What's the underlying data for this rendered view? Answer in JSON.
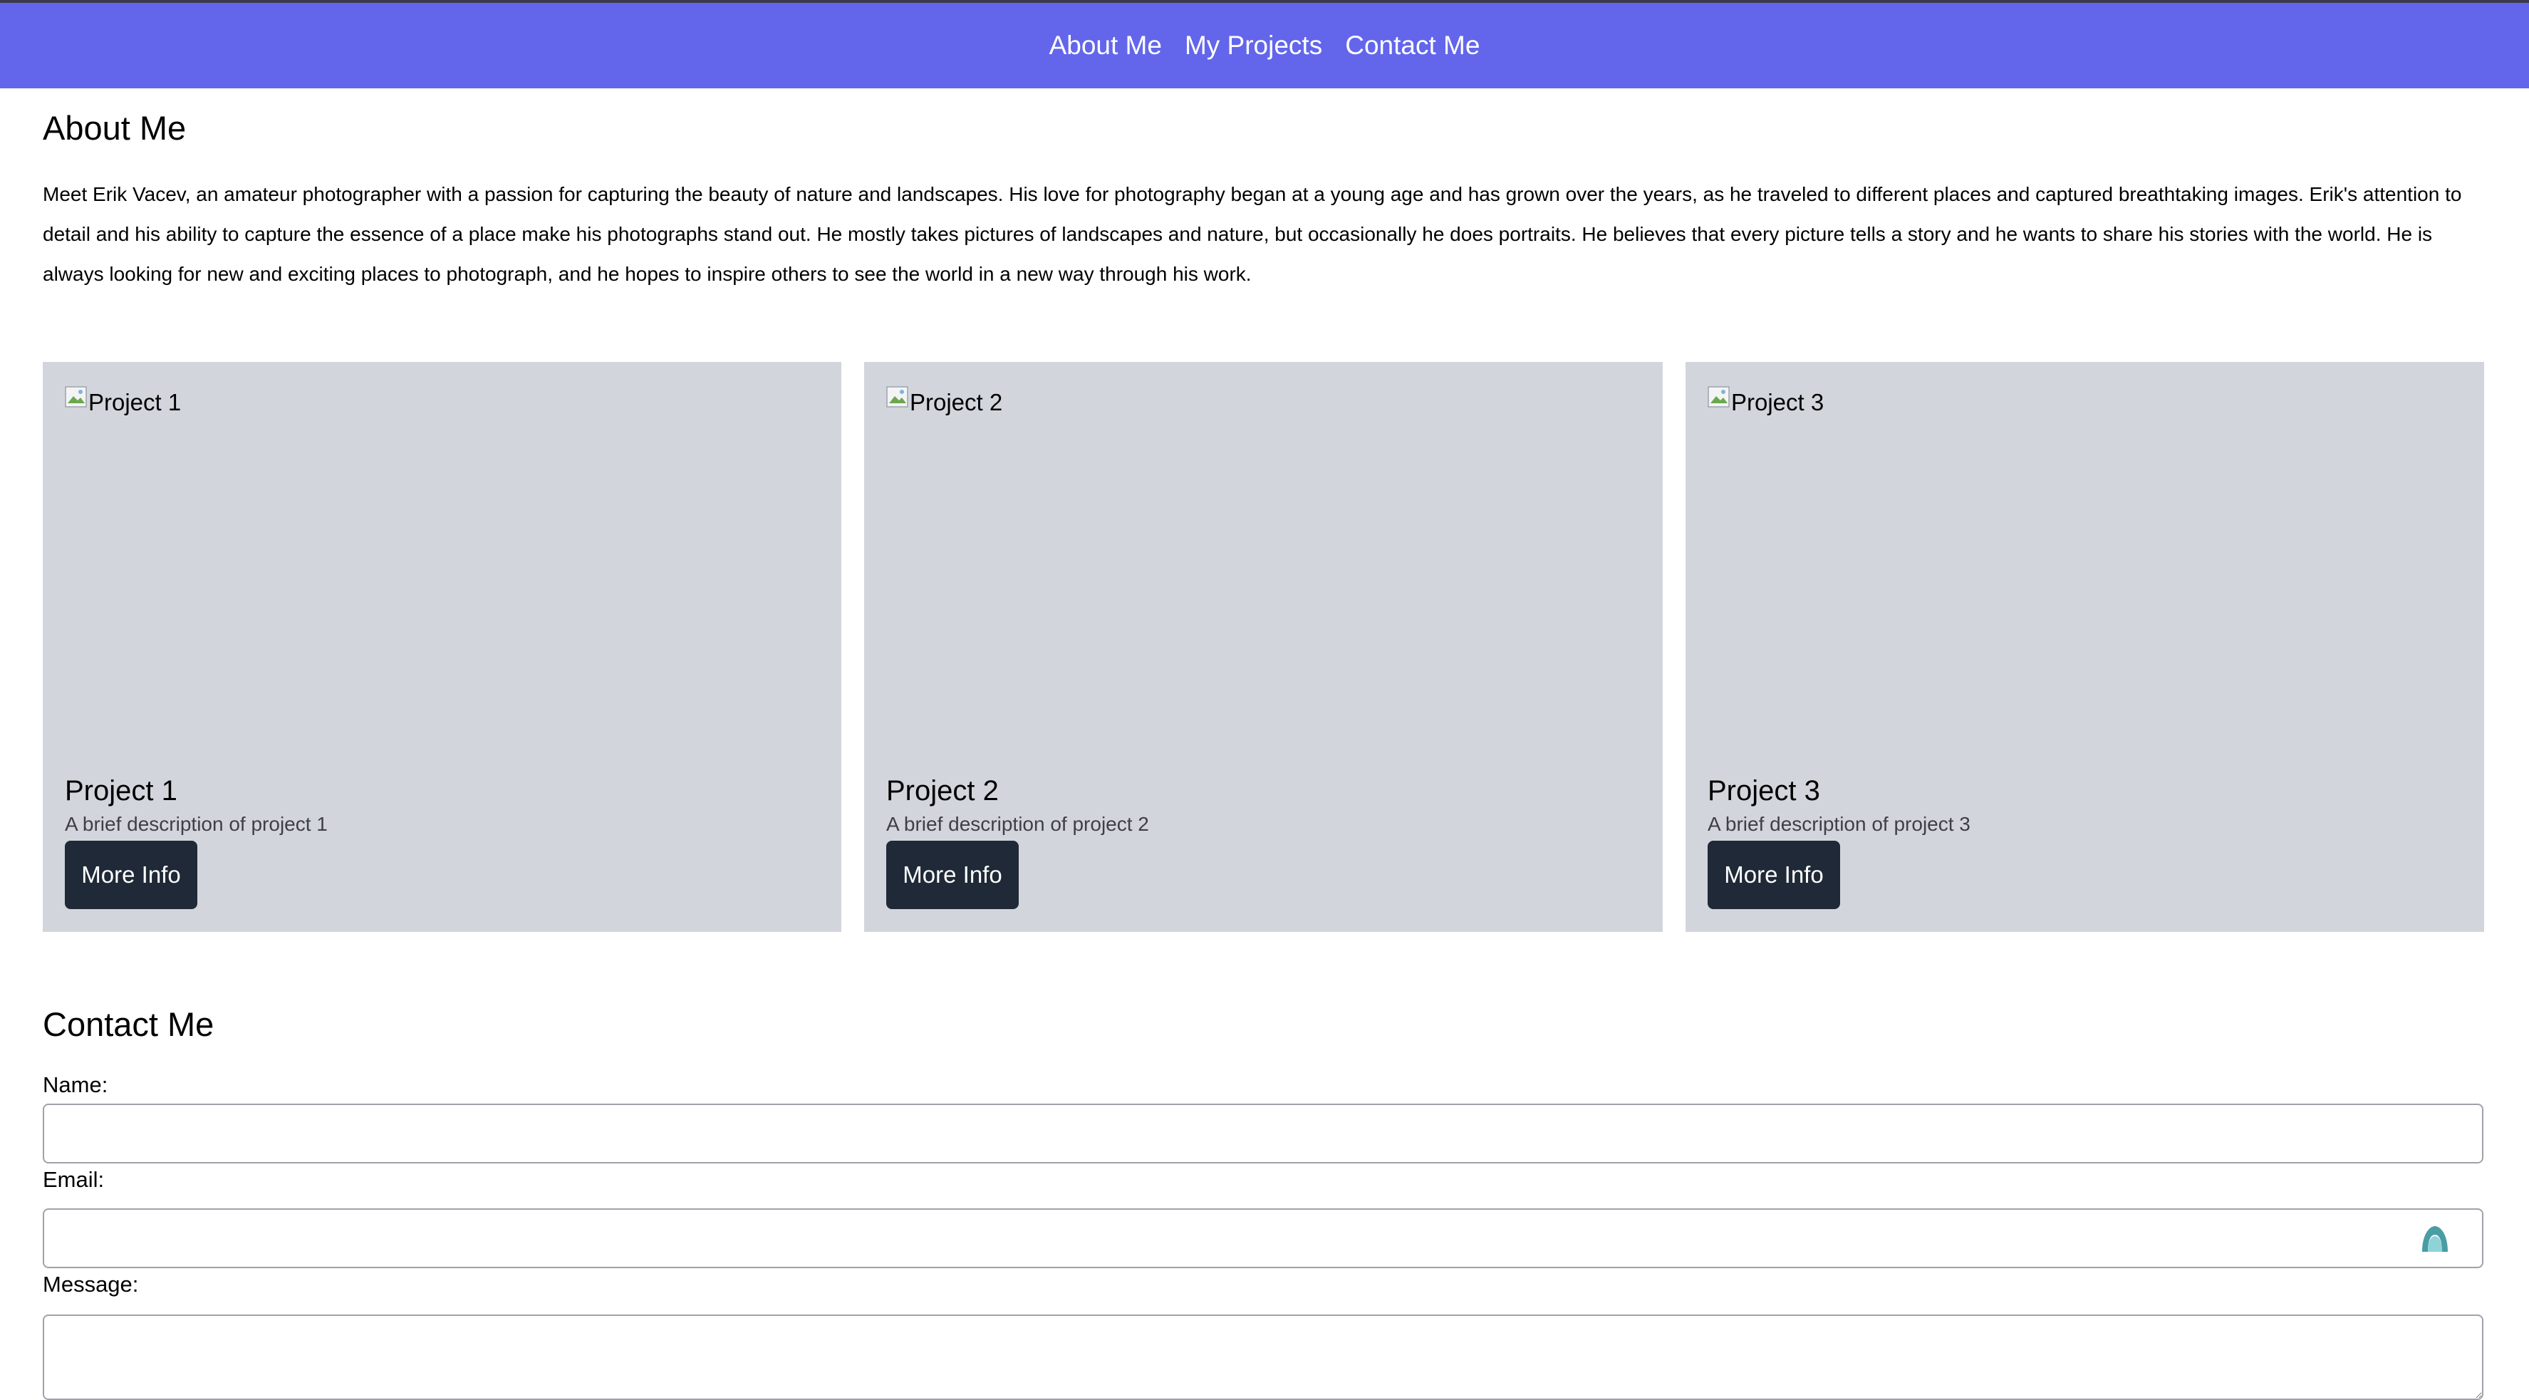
{
  "nav": {
    "items": [
      {
        "label": "About Me"
      },
      {
        "label": "My Projects"
      },
      {
        "label": "Contact Me"
      }
    ]
  },
  "about": {
    "title": "About Me",
    "text": "Meet Erik Vacev, an amateur photographer with a passion for capturing the beauty of nature and landscapes. His love for photography began at a young age and has grown over the years, as he traveled to different places and captured breathtaking images. Erik's attention to detail and his ability to capture the essence of a place make his photographs stand out. He mostly takes pictures of landscapes and nature, but occasionally he does portraits. He believes that every picture tells a story and he wants to share his stories with the world. He is always looking for new and exciting places to photograph, and he hopes to inspire others to see the world in a new way through his work."
  },
  "projects": [
    {
      "img_alt": "Project 1",
      "title": "Project 1",
      "description": "A brief description of project 1",
      "button": "More Info"
    },
    {
      "img_alt": "Project 2",
      "title": "Project 2",
      "description": "A brief description of project 2",
      "button": "More Info"
    },
    {
      "img_alt": "Project 3",
      "title": "Project 3",
      "description": "A brief description of project 3",
      "button": "More Info"
    }
  ],
  "contact": {
    "title": "Contact Me",
    "name_label": "Name:",
    "name_value": "",
    "email_label": "Email:",
    "email_value": "",
    "message_label": "Message:",
    "message_value": ""
  },
  "colors": {
    "nav_background": "#6366eb",
    "card_background": "#d2d6dc",
    "button_background": "#1f2937"
  },
  "icons": {
    "broken_image": "broken-image-icon",
    "email_field_extension": "password-manager-icon"
  }
}
